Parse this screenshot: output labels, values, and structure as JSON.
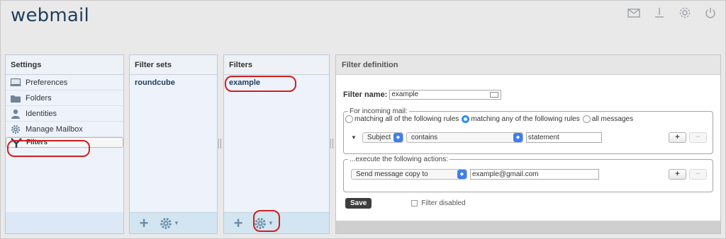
{
  "app": {
    "title": "webmail"
  },
  "topbar": {
    "icons": [
      "mail-icon",
      "download-icon",
      "gear-icon",
      "power-icon"
    ]
  },
  "settings": {
    "header": "Settings",
    "items": [
      {
        "label": "Preferences",
        "icon": "monitor-icon"
      },
      {
        "label": "Folders",
        "icon": "folder-icon"
      },
      {
        "label": "Identities",
        "icon": "person-icon"
      },
      {
        "label": "Manage Mailbox",
        "icon": "gear-icon"
      },
      {
        "label": "Filters",
        "icon": "filter-icon",
        "selected": true
      }
    ]
  },
  "filter_sets": {
    "header": "Filter sets",
    "items": [
      "roundcube"
    ],
    "add_label": "+"
  },
  "filters": {
    "header": "Filters",
    "items": [
      "example"
    ],
    "add_label": "+"
  },
  "definition": {
    "header": "Filter definition",
    "name_label": "Filter name:",
    "name_value": "example",
    "incoming_legend": "For incoming mail:",
    "match_options": [
      {
        "label": "matching all of the following rules",
        "checked": false
      },
      {
        "label": "matching any of the following rules",
        "checked": true
      },
      {
        "label": "all messages",
        "checked": false
      }
    ],
    "rule": {
      "header": "Subject",
      "operator": "contains",
      "value": "statement"
    },
    "actions_legend": "...execute the following actions:",
    "action": {
      "type": "Send message copy to",
      "value": "example@gmail.com"
    },
    "plus_label": "+",
    "minus_label": "−",
    "save_label": "Save",
    "disabled_label": "Filter disabled",
    "disabled_checked": false
  },
  "colors": {
    "highlight": "#d11e1e",
    "accent": "#2d8df2",
    "panel_bg": "#dce8f5"
  }
}
